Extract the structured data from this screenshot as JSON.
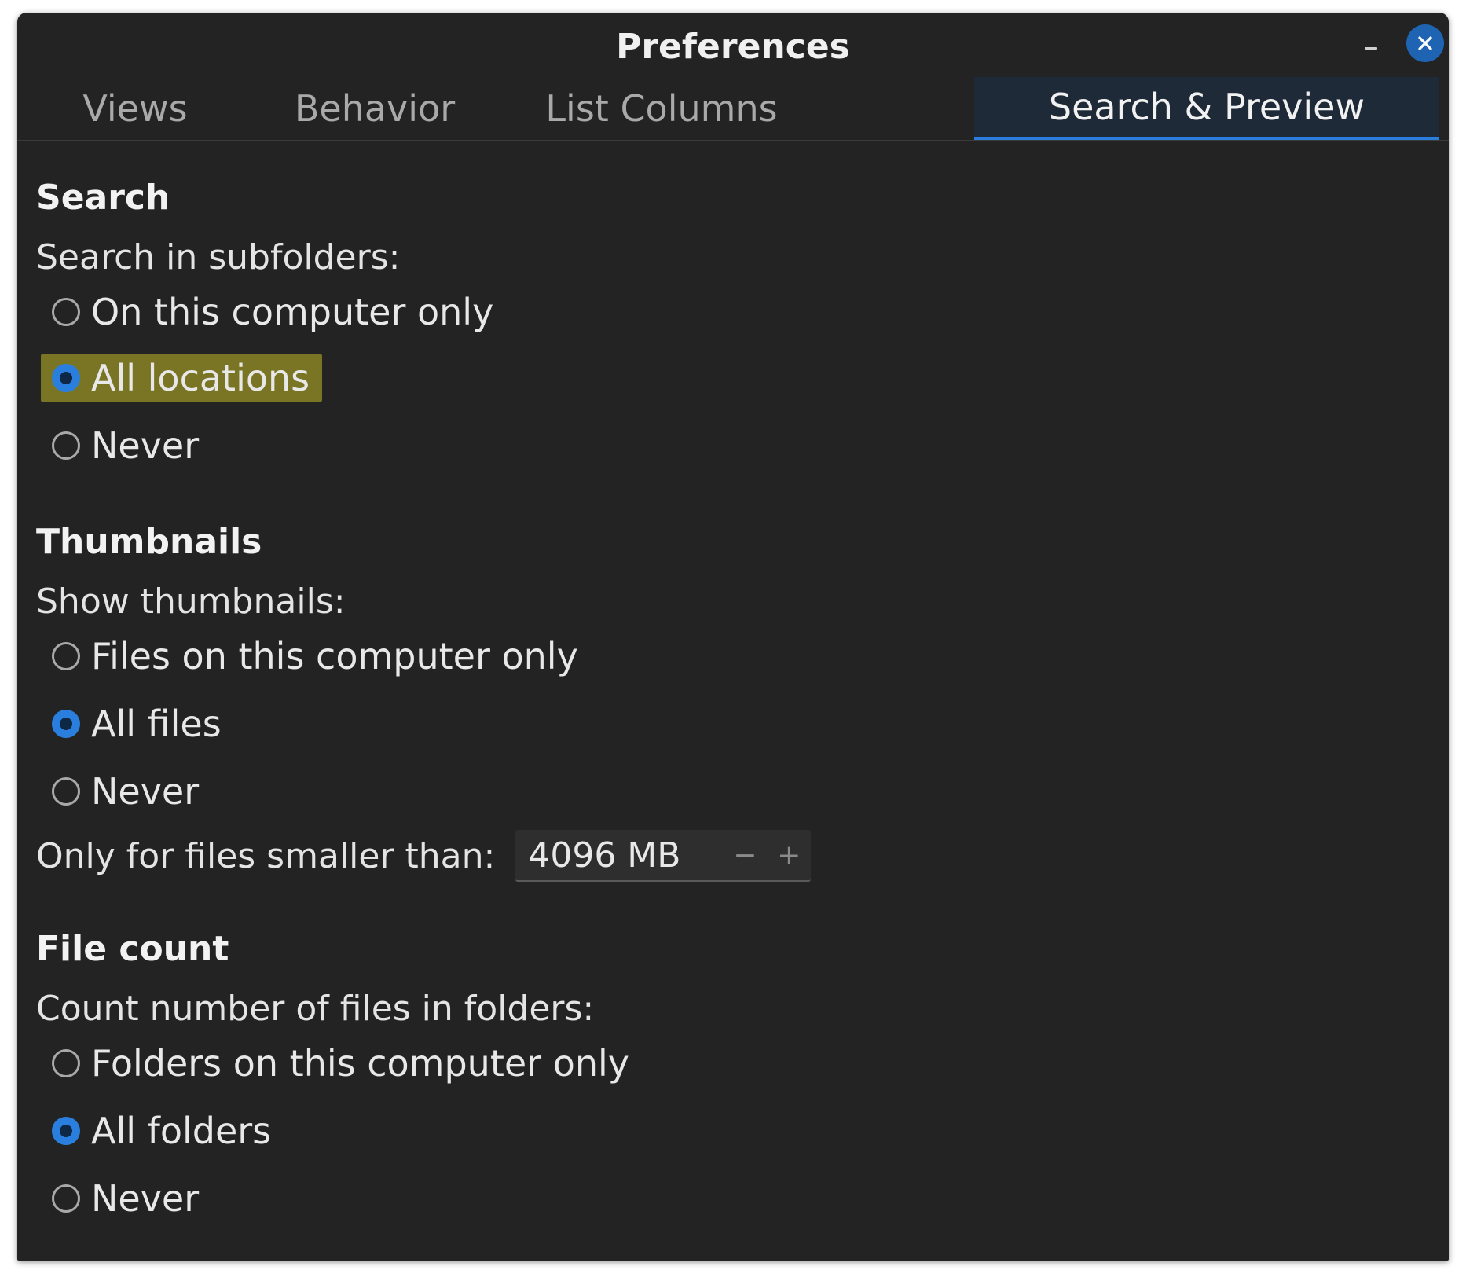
{
  "window": {
    "title": "Preferences",
    "accent_color": "#2a7fde",
    "close_button_color": "#1f64b3",
    "focus_highlight_color": "#7a7425"
  },
  "tabs": [
    {
      "label": "Views",
      "active": false
    },
    {
      "label": "Behavior",
      "active": false
    },
    {
      "label": "List Columns",
      "active": false
    },
    {
      "label": "Search & Preview",
      "active": true
    }
  ],
  "search": {
    "heading": "Search",
    "label": "Search in subfolders:",
    "options": [
      {
        "label": "On this computer only",
        "checked": false
      },
      {
        "label": "All locations",
        "checked": true
      },
      {
        "label": "Never",
        "checked": false
      }
    ]
  },
  "thumbnails": {
    "heading": "Thumbnails",
    "label": "Show thumbnails:",
    "options": [
      {
        "label": "Files on this computer only",
        "checked": false
      },
      {
        "label": "All files",
        "checked": true
      },
      {
        "label": "Never",
        "checked": false
      }
    ],
    "size_limit_label": "Only for files smaller than:",
    "size_limit_value": "4096 MB",
    "decrement_symbol": "−",
    "increment_symbol": "+"
  },
  "file_count": {
    "heading": "File count",
    "label": "Count number of files in folders:",
    "options": [
      {
        "label": "Folders on this computer only",
        "checked": false
      },
      {
        "label": "All folders",
        "checked": true
      },
      {
        "label": "Never",
        "checked": false
      }
    ]
  }
}
